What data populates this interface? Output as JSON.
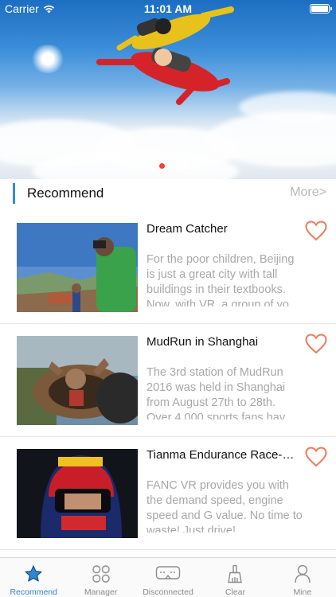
{
  "status_bar": {
    "carrier": "Carrier",
    "time": "11:01 AM"
  },
  "banner": {
    "slide_count": 3,
    "active_slide": 1
  },
  "section": {
    "title": "Recommend",
    "more": "More>"
  },
  "cards": [
    {
      "title": "Dream Catcher",
      "description": "For the poor children, Beijing is just a great city with tall buildings in their textbooks. Now, with VR, a group of yo..."
    },
    {
      "title": "MudRun in Shanghai",
      "description": "The 3rd station of MudRun 2016 was held in Shanghai from August 27th to 28th. Over 4,000 sports fans hav..."
    },
    {
      "title": "Tianma Endurance Race-Ri...",
      "description": "FANC VR provides you with the demand speed, engine speed and G value. No time to waste! Just drive!"
    }
  ],
  "tabs": [
    {
      "label": "Recommend",
      "icon": "star-icon",
      "active": true
    },
    {
      "label": "Manager",
      "icon": "grid-icon",
      "active": false
    },
    {
      "label": "Disconnected",
      "icon": "vr-headset-icon",
      "active": false
    },
    {
      "label": "Clear",
      "icon": "broom-icon",
      "active": false
    },
    {
      "label": "Mine",
      "icon": "person-icon",
      "active": false
    }
  ],
  "colors": {
    "accent": "#2f86d6",
    "heart": "#f07a56",
    "active_dot": "#f2442a"
  }
}
